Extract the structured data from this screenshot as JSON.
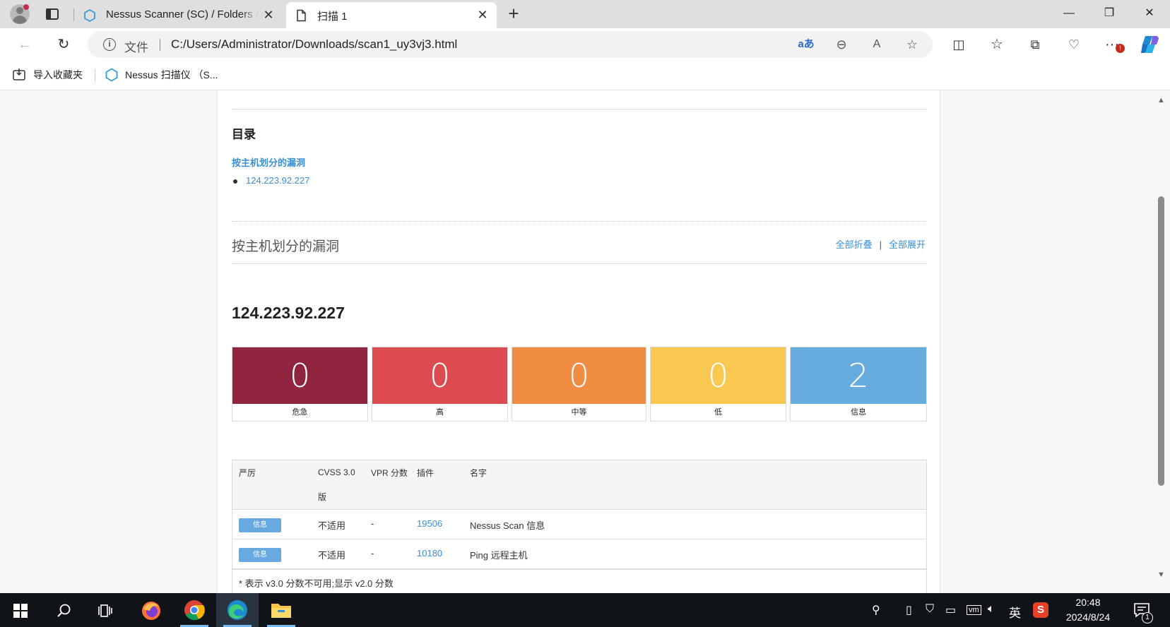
{
  "browser": {
    "tabs": [
      {
        "title": "Nessus Scanner (SC) / Folders / V",
        "active": false
      },
      {
        "title": "扫描 1",
        "active": true
      }
    ],
    "address": {
      "scheme_label": "文件",
      "url": "C:/Users/Administrator/Downloads/scan1_uy3vj3.html"
    },
    "bookmarks": [
      {
        "label": "导入收藏夹"
      },
      {
        "label": "Nessus 扫描仪 （S..."
      }
    ]
  },
  "report": {
    "toc": {
      "title": "目录",
      "section_link": "按主机划分的漏洞",
      "hosts": [
        "124.223.92.227"
      ]
    },
    "section": {
      "title": "按主机划分的漏洞",
      "collapse_all": "全部折叠",
      "separator": "|",
      "expand_all": "全部展开"
    },
    "host": {
      "ip": "124.223.92.227",
      "severity_counts": [
        {
          "label": "危急",
          "count": "0",
          "color": "#91243e"
        },
        {
          "label": "高",
          "count": "0",
          "color": "#dd4b50"
        },
        {
          "label": "中等",
          "count": "0",
          "color": "#f18c43"
        },
        {
          "label": "低",
          "count": "0",
          "color": "#f8c851"
        },
        {
          "label": "信息",
          "count": "2",
          "color": "#67acdf"
        }
      ],
      "table": {
        "headers": {
          "severity": "严厉",
          "cvss_line1": "CVSS 3.0",
          "cvss_line2": "版",
          "vpr": "VPR 分数",
          "plugin": "插件",
          "name": "名字"
        },
        "rows": [
          {
            "severity": "信息",
            "cvss": "不适用",
            "vpr": "-",
            "plugin": "19506",
            "name": "Nessus Scan 信息"
          },
          {
            "severity": "信息",
            "cvss": "不适用",
            "vpr": "-",
            "plugin": "10180",
            "name": "Ping 远程主机"
          }
        ],
        "footnote": "* 表示 v3.0 分数不可用;显示 v2.0 分数"
      }
    }
  },
  "taskbar": {
    "ime_label": "英",
    "time": "20:48",
    "date": "2024/8/24",
    "notification_count": "1"
  }
}
